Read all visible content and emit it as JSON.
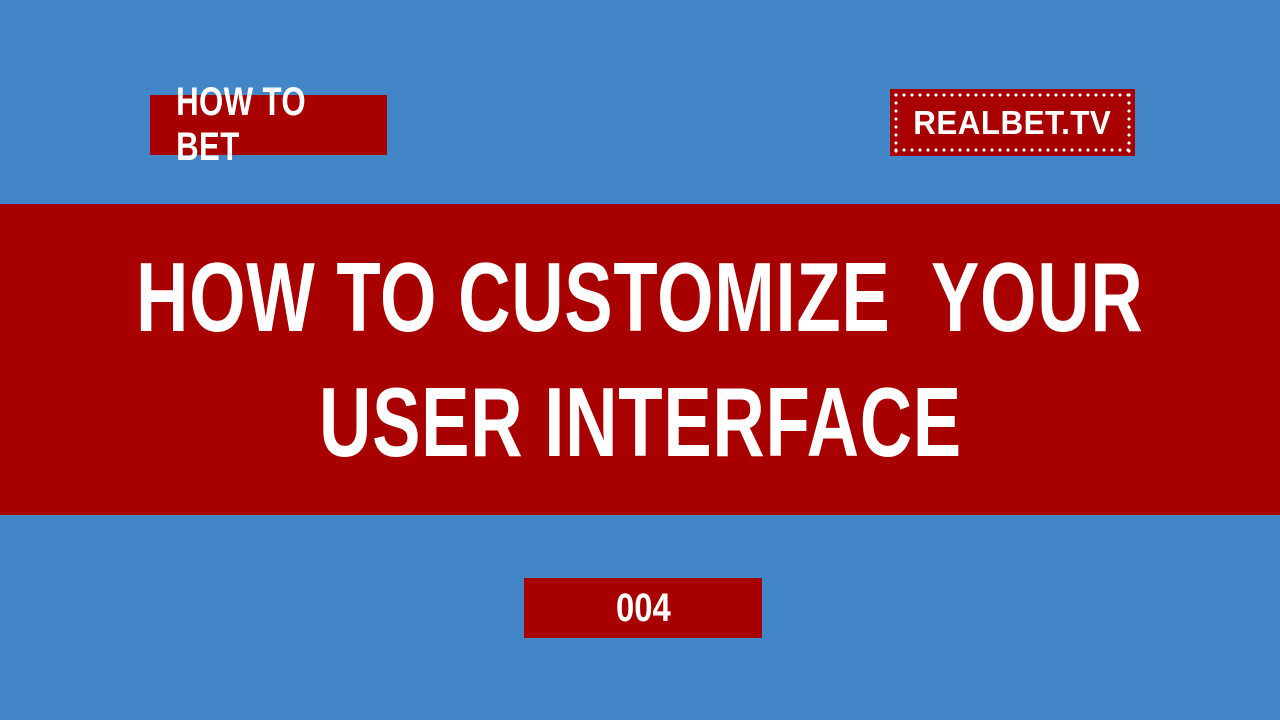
{
  "category_label": "HOW TO BET",
  "brand_logo_text": "REALBET.TV",
  "title": {
    "line1": "HOW TO CUSTOMIZE  YOUR",
    "line2": "USER INTERFACE"
  },
  "episode_number": "004",
  "colors": {
    "background": "#4286c7",
    "accent_red": "#a80000",
    "text": "#ffffff"
  }
}
